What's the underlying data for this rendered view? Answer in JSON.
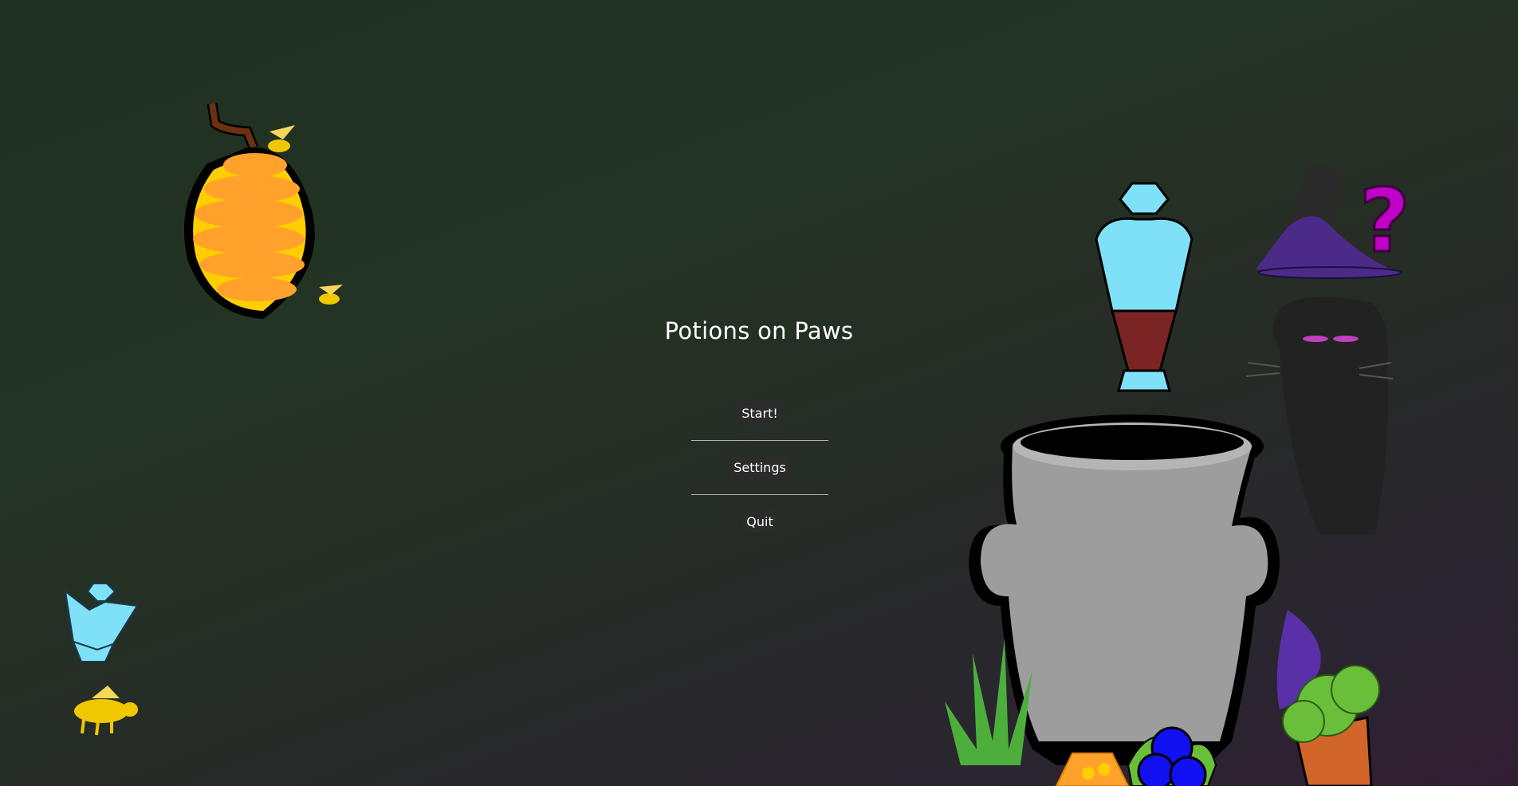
{
  "title": "Potions on Paws",
  "menu": {
    "start_label": "Start!",
    "settings_label": "Settings",
    "quit_label": "Quit"
  },
  "icons": {
    "question_mark": "?"
  },
  "colors": {
    "honey_orange": "#ffa12a",
    "honey_yellow": "#ffce00",
    "bee_yellow": "#f0c800",
    "crystal_blue": "#7fe1f8",
    "potion_red": "#7a2424",
    "cauldron_gray": "#9d9d9d",
    "hat_purple": "#4b2a88",
    "question_magenta": "#c000c8",
    "berry_blue": "#1010f0",
    "leaf_green": "#6abf3a",
    "pot_terracotta": "#d2652a"
  }
}
